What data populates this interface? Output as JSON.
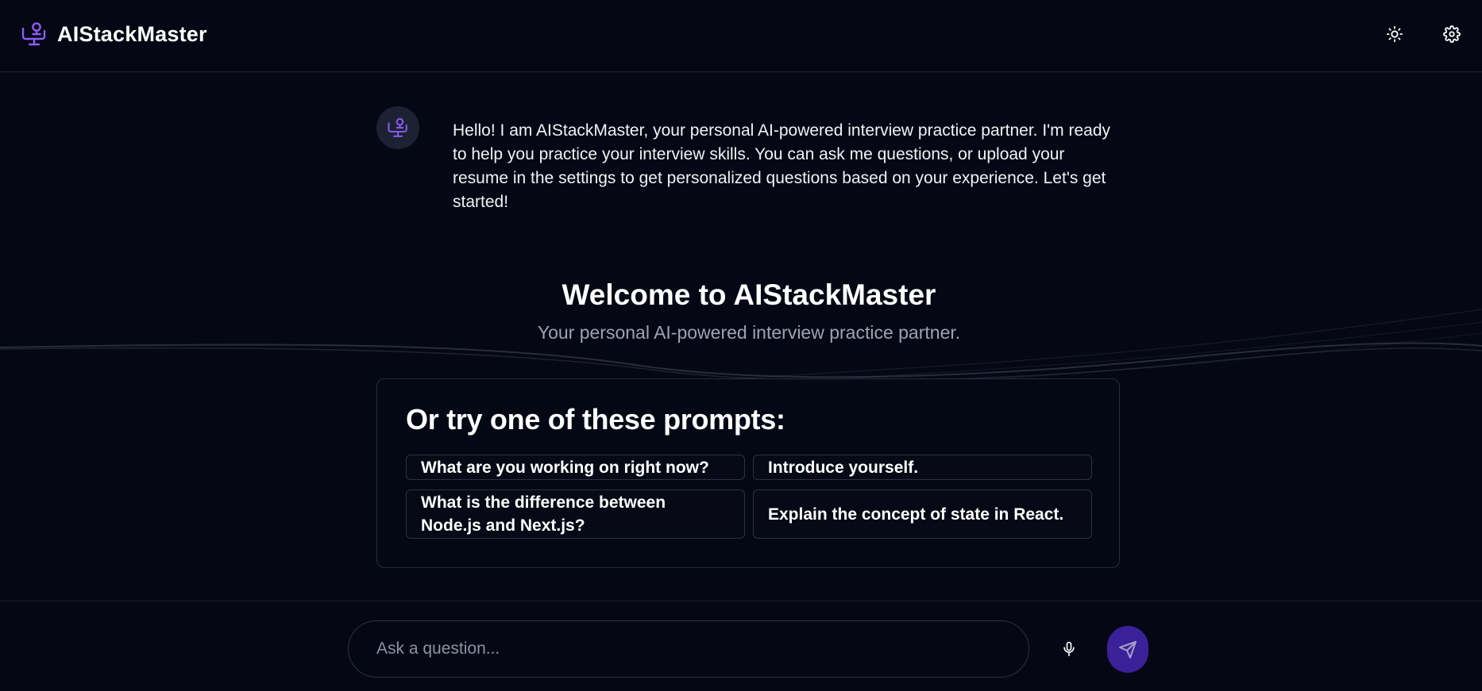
{
  "app": {
    "name": "AIStackMaster",
    "accent": "#7c4dff"
  },
  "header": {
    "theme_toggle_icon": "sun-icon",
    "settings_icon": "gear-icon"
  },
  "chat": {
    "bot_avatar_icon": "brand-logo-icon",
    "bot_message": "Hello! I am AIStackMaster, your personal AI-powered interview practice partner. I'm ready to help you practice your interview skills. You can ask me questions, or upload your resume in the settings to get personalized questions based on your experience. Let's get started!"
  },
  "welcome": {
    "title": "Welcome to AIStackMaster",
    "subtitle": "Your personal AI-powered interview practice partner."
  },
  "prompts": {
    "title": "Or try one of these prompts:",
    "items": [
      "What are you working on right now?",
      "Introduce yourself.",
      "What is the difference between Node.js and Next.js?",
      "Explain the concept of state in React."
    ]
  },
  "composer": {
    "placeholder": "Ask a question...",
    "mic_icon": "microphone-icon",
    "send_icon": "send-icon",
    "send_color": "#3b2199"
  }
}
